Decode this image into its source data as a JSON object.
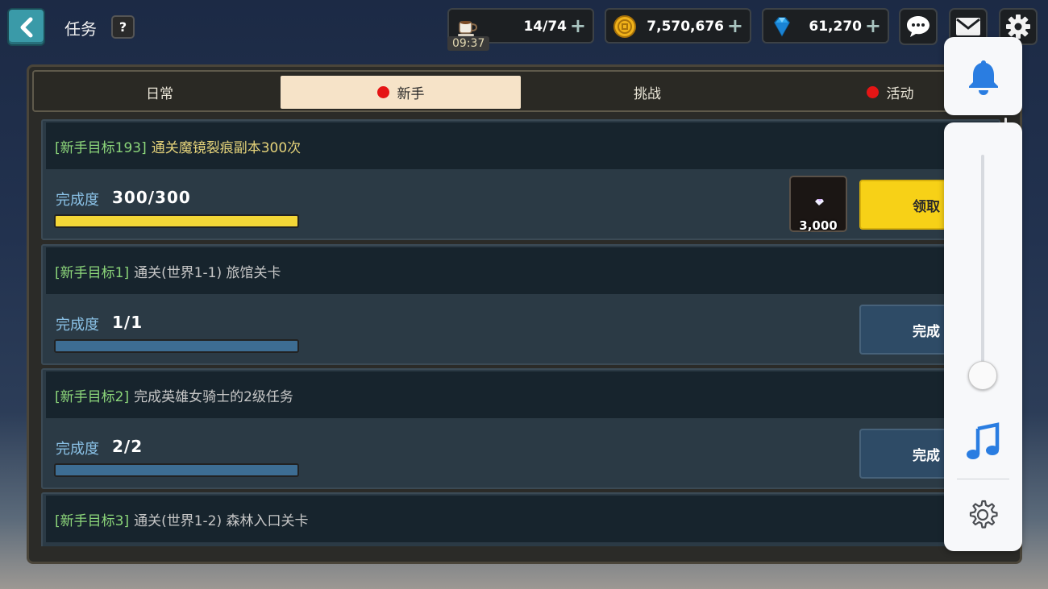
{
  "header": {
    "title": "任务",
    "help_label": "?",
    "stamina": {
      "value": "14/74",
      "timer": "09:37",
      "plus": "+"
    },
    "gold": {
      "value": "7,570,676",
      "plus": "+"
    },
    "gems": {
      "value": "61,270",
      "plus": "+"
    },
    "icons": [
      "back-icon",
      "coffee-icon",
      "coin-icon",
      "diamond-icon",
      "chat-icon",
      "mail-icon",
      "gear-icon"
    ]
  },
  "tabs": [
    {
      "label": "日常",
      "active": false,
      "dot": false
    },
    {
      "label": "新手",
      "active": true,
      "dot": true
    },
    {
      "label": "挑战",
      "active": false,
      "dot": false
    },
    {
      "label": "活动",
      "active": false,
      "dot": true
    }
  ],
  "progress_label": "完成度",
  "quests": [
    {
      "tag": "[新手目标193]",
      "desc": "通关魔镜裂痕副本300次",
      "progress": "300/300",
      "fill_percent": 100,
      "bar_color": "#f4d737",
      "reward_amount": "3,000",
      "button": "领取",
      "button_type": "claim"
    },
    {
      "tag": "[新手目标1]",
      "desc": "通关(世界1-1) 旅馆关卡",
      "progress": "1/1",
      "fill_percent": 100,
      "bar_color": "#3d6d93",
      "reward_amount": "",
      "button": "完成",
      "button_type": "done"
    },
    {
      "tag": "[新手目标2]",
      "desc": "完成英雄女骑士的2级任务",
      "progress": "2/2",
      "fill_percent": 100,
      "bar_color": "#3d6d93",
      "reward_amount": "",
      "button": "完成",
      "button_type": "done"
    },
    {
      "tag": "[新手目标3]",
      "desc": "通关(世界1-2) 森林入口关卡",
      "progress": "",
      "fill_percent": 0,
      "bar_color": "#3d6d93",
      "reward_amount": "",
      "button": "",
      "button_type": ""
    }
  ],
  "overlay": {
    "icons": [
      "bell-icon",
      "music-note-icon",
      "settings-icon"
    ],
    "accent_color": "#2a7de1",
    "volume_level": 0.07
  }
}
